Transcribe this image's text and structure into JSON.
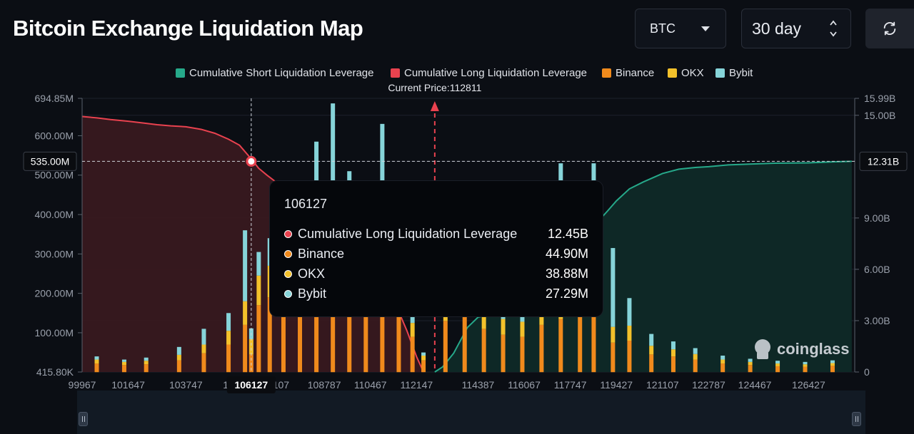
{
  "header": {
    "title": "Bitcoin Exchange Liquidation Map"
  },
  "controls": {
    "coin": "BTC",
    "period": "30 day",
    "refresh_icon": "refresh-icon"
  },
  "colors": {
    "short": "#26a98a",
    "long": "#e9424f",
    "binance": "#f08a1c",
    "okx": "#f3c12b",
    "bybit": "#86d4d9",
    "background": "#0b0e14"
  },
  "watermark": "coinglass",
  "tooltip": {
    "title": "106127",
    "rows": [
      {
        "name": "Cumulative Long Liquidation Leverage",
        "value": "12.45B",
        "color": "#e9424f"
      },
      {
        "name": "Binance",
        "value": "44.90M",
        "color": "#f08a1c"
      },
      {
        "name": "OKX",
        "value": "38.88M",
        "color": "#f3c12b"
      },
      {
        "name": "Bybit",
        "value": "27.29M",
        "color": "#86d4d9"
      }
    ]
  },
  "chart_data": {
    "type": "bar",
    "title": "Bitcoin Exchange Liquidation Map",
    "legend_position": "top-center",
    "legend": [
      {
        "name": "Cumulative Short Liquidation Leverage",
        "color": "#26a98a"
      },
      {
        "name": "Cumulative Long Liquidation Leverage",
        "color": "#e9424f"
      },
      {
        "name": "Binance",
        "color": "#f08a1c"
      },
      {
        "name": "OKX",
        "color": "#f3c12b"
      },
      {
        "name": "Bybit",
        "color": "#86d4d9"
      }
    ],
    "current_price_label": "Current Price:112811",
    "current_price": 112811,
    "x_range": [
      99967,
      128107
    ],
    "x_tick_labels": [
      "99967",
      "101647",
      "103747",
      "105",
      "7107",
      "108787",
      "110467",
      "112147",
      "114387",
      "116067",
      "117747",
      "119427",
      "121107",
      "122787",
      "124467",
      "126427"
    ],
    "x_tick_values": [
      99967,
      101647,
      103747,
      105400,
      107107,
      108787,
      110467,
      112147,
      114387,
      116067,
      117747,
      119427,
      121107,
      122787,
      124467,
      126427
    ],
    "crosshair_x_label": "106127",
    "crosshair_x": 106127,
    "left_axis": {
      "ticks": [
        0.4158,
        100,
        200,
        300,
        400,
        500,
        600,
        694.85
      ],
      "tick_labels": [
        "415.80K",
        "100.00M",
        "200.00M",
        "300.00M",
        "400.00M",
        "500.00M",
        "600.00M",
        "694.85M"
      ],
      "range": [
        0.4158,
        694.85
      ],
      "unit": "M",
      "crosshair_label": "535.00M",
      "crosshair_value": 535
    },
    "right_axis": {
      "ticks": [
        0,
        3,
        6,
        9,
        12.31,
        15,
        15.99
      ],
      "tick_labels": [
        "0",
        "3.00B",
        "6.00B",
        "9.00B",
        "12.31B",
        "15.00B",
        "15.99B"
      ],
      "range": [
        0,
        15.99
      ],
      "unit": "B",
      "crosshair_label": "12.31B",
      "crosshair_value": 12.31
    },
    "long_cumulative": {
      "name": "Cumulative Long Liquidation Leverage",
      "x": [
        99967,
        100500,
        101000,
        101647,
        102200,
        102700,
        103200,
        103747,
        104300,
        104800,
        105300,
        105700,
        106127,
        106400,
        106700,
        107107,
        107600,
        108200,
        108787,
        109300,
        109800,
        110467,
        110900,
        111400,
        111800,
        112147,
        112400
      ],
      "y": [
        14.93,
        14.85,
        14.75,
        14.65,
        14.55,
        14.45,
        14.38,
        14.33,
        14.18,
        13.95,
        13.6,
        13.25,
        12.45,
        11.9,
        11.5,
        11.0,
        10.7,
        10.2,
        9.3,
        8.6,
        7.7,
        6.5,
        5.3,
        3.9,
        2.4,
        0.9,
        0.0
      ]
    },
    "short_cumulative": {
      "name": "Cumulative Short Liquidation Leverage",
      "x": [
        112811,
        113100,
        113500,
        114000,
        114387,
        114900,
        115500,
        116067,
        116600,
        117100,
        117747,
        118200,
        118700,
        119100,
        119427,
        119900,
        120400,
        121107,
        121700,
        122300,
        122787,
        123500,
        124467,
        125200,
        126427,
        127300,
        128000
      ],
      "y": [
        0.0,
        0.3,
        1.1,
        2.6,
        3.2,
        3.4,
        3.6,
        3.95,
        4.5,
        5.6,
        7.0,
        8.2,
        8.7,
        9.4,
        10.0,
        10.7,
        11.1,
        11.6,
        11.85,
        11.95,
        12.0,
        12.1,
        12.16,
        12.2,
        12.22,
        12.28,
        12.31
      ]
    },
    "exchanges": {
      "series": [
        {
          "name": "Binance",
          "values": [
            {
              "x": 100500,
              "y": 22
            },
            {
              "x": 101500,
              "y": 18
            },
            {
              "x": 102300,
              "y": 20
            },
            {
              "x": 103500,
              "y": 30
            },
            {
              "x": 104400,
              "y": 48
            },
            {
              "x": 105300,
              "y": 70
            },
            {
              "x": 105900,
              "y": 120
            },
            {
              "x": 106127,
              "y": 44.9
            },
            {
              "x": 106400,
              "y": 170
            },
            {
              "x": 106800,
              "y": 190
            },
            {
              "x": 107300,
              "y": 175
            },
            {
              "x": 107900,
              "y": 185
            },
            {
              "x": 108500,
              "y": 200
            },
            {
              "x": 109100,
              "y": 205
            },
            {
              "x": 109700,
              "y": 210
            },
            {
              "x": 110300,
              "y": 208
            },
            {
              "x": 110900,
              "y": 190
            },
            {
              "x": 111500,
              "y": 150
            },
            {
              "x": 112000,
              "y": 90
            },
            {
              "x": 112400,
              "y": 30
            },
            {
              "x": 113200,
              "y": 130
            },
            {
              "x": 113900,
              "y": 140
            },
            {
              "x": 114600,
              "y": 110
            },
            {
              "x": 115300,
              "y": 95
            },
            {
              "x": 116000,
              "y": 90
            },
            {
              "x": 116700,
              "y": 120
            },
            {
              "x": 117400,
              "y": 135
            },
            {
              "x": 118100,
              "y": 150
            },
            {
              "x": 118600,
              "y": 140
            },
            {
              "x": 119300,
              "y": 75
            },
            {
              "x": 119900,
              "y": 80
            },
            {
              "x": 120700,
              "y": 45
            },
            {
              "x": 121500,
              "y": 40
            },
            {
              "x": 122300,
              "y": 32
            },
            {
              "x": 123300,
              "y": 22
            },
            {
              "x": 124300,
              "y": 18
            },
            {
              "x": 125300,
              "y": 15
            },
            {
              "x": 126300,
              "y": 14
            },
            {
              "x": 127300,
              "y": 16
            }
          ]
        },
        {
          "name": "OKX",
          "values": [
            {
              "x": 100500,
              "y": 10
            },
            {
              "x": 101500,
              "y": 8
            },
            {
              "x": 102300,
              "y": 9
            },
            {
              "x": 103500,
              "y": 14
            },
            {
              "x": 104400,
              "y": 22
            },
            {
              "x": 105300,
              "y": 35
            },
            {
              "x": 105900,
              "y": 60
            },
            {
              "x": 106127,
              "y": 38.88
            },
            {
              "x": 106400,
              "y": 75
            },
            {
              "x": 106800,
              "y": 80
            },
            {
              "x": 107300,
              "y": 75
            },
            {
              "x": 107900,
              "y": 78
            },
            {
              "x": 108500,
              "y": 85
            },
            {
              "x": 109100,
              "y": 82
            },
            {
              "x": 109700,
              "y": 80
            },
            {
              "x": 110300,
              "y": 78
            },
            {
              "x": 110900,
              "y": 70
            },
            {
              "x": 111500,
              "y": 55
            },
            {
              "x": 112000,
              "y": 35
            },
            {
              "x": 112400,
              "y": 12
            },
            {
              "x": 113200,
              "y": 55
            },
            {
              "x": 113900,
              "y": 60
            },
            {
              "x": 114600,
              "y": 48
            },
            {
              "x": 115300,
              "y": 40
            },
            {
              "x": 116000,
              "y": 38
            },
            {
              "x": 116700,
              "y": 50
            },
            {
              "x": 117400,
              "y": 55
            },
            {
              "x": 118100,
              "y": 65
            },
            {
              "x": 118600,
              "y": 60
            },
            {
              "x": 119300,
              "y": 40
            },
            {
              "x": 119900,
              "y": 38
            },
            {
              "x": 120700,
              "y": 22
            },
            {
              "x": 121500,
              "y": 18
            },
            {
              "x": 122300,
              "y": 14
            },
            {
              "x": 123300,
              "y": 10
            },
            {
              "x": 124300,
              "y": 8
            },
            {
              "x": 125300,
              "y": 7
            },
            {
              "x": 126300,
              "y": 6
            },
            {
              "x": 127300,
              "y": 7
            }
          ]
        },
        {
          "name": "Bybit",
          "values": [
            {
              "x": 100500,
              "y": 8
            },
            {
              "x": 101500,
              "y": 6
            },
            {
              "x": 102300,
              "y": 8
            },
            {
              "x": 103500,
              "y": 20
            },
            {
              "x": 104400,
              "y": 40
            },
            {
              "x": 105300,
              "y": 45
            },
            {
              "x": 105900,
              "y": 180
            },
            {
              "x": 106127,
              "y": 27.29
            },
            {
              "x": 106400,
              "y": 60
            },
            {
              "x": 106800,
              "y": 70
            },
            {
              "x": 107300,
              "y": 50
            },
            {
              "x": 107900,
              "y": 60
            },
            {
              "x": 108500,
              "y": 300
            },
            {
              "x": 109100,
              "y": 395
            },
            {
              "x": 109700,
              "y": 220
            },
            {
              "x": 110300,
              "y": 100
            },
            {
              "x": 110900,
              "y": 370
            },
            {
              "x": 111500,
              "y": 60
            },
            {
              "x": 112000,
              "y": 40
            },
            {
              "x": 112400,
              "y": 8
            },
            {
              "x": 113200,
              "y": 40
            },
            {
              "x": 113900,
              "y": 215
            },
            {
              "x": 114600,
              "y": 40
            },
            {
              "x": 115300,
              "y": 30
            },
            {
              "x": 116000,
              "y": 30
            },
            {
              "x": 116700,
              "y": 50
            },
            {
              "x": 117400,
              "y": 340
            },
            {
              "x": 118100,
              "y": 55
            },
            {
              "x": 118600,
              "y": 330
            },
            {
              "x": 119300,
              "y": 200
            },
            {
              "x": 119900,
              "y": 70
            },
            {
              "x": 120700,
              "y": 30
            },
            {
              "x": 121500,
              "y": 20
            },
            {
              "x": 122300,
              "y": 15
            },
            {
              "x": 123300,
              "y": 10
            },
            {
              "x": 124300,
              "y": 8
            },
            {
              "x": 125300,
              "y": 7
            },
            {
              "x": 126300,
              "y": 6
            },
            {
              "x": 127300,
              "y": 7
            }
          ]
        }
      ]
    }
  }
}
